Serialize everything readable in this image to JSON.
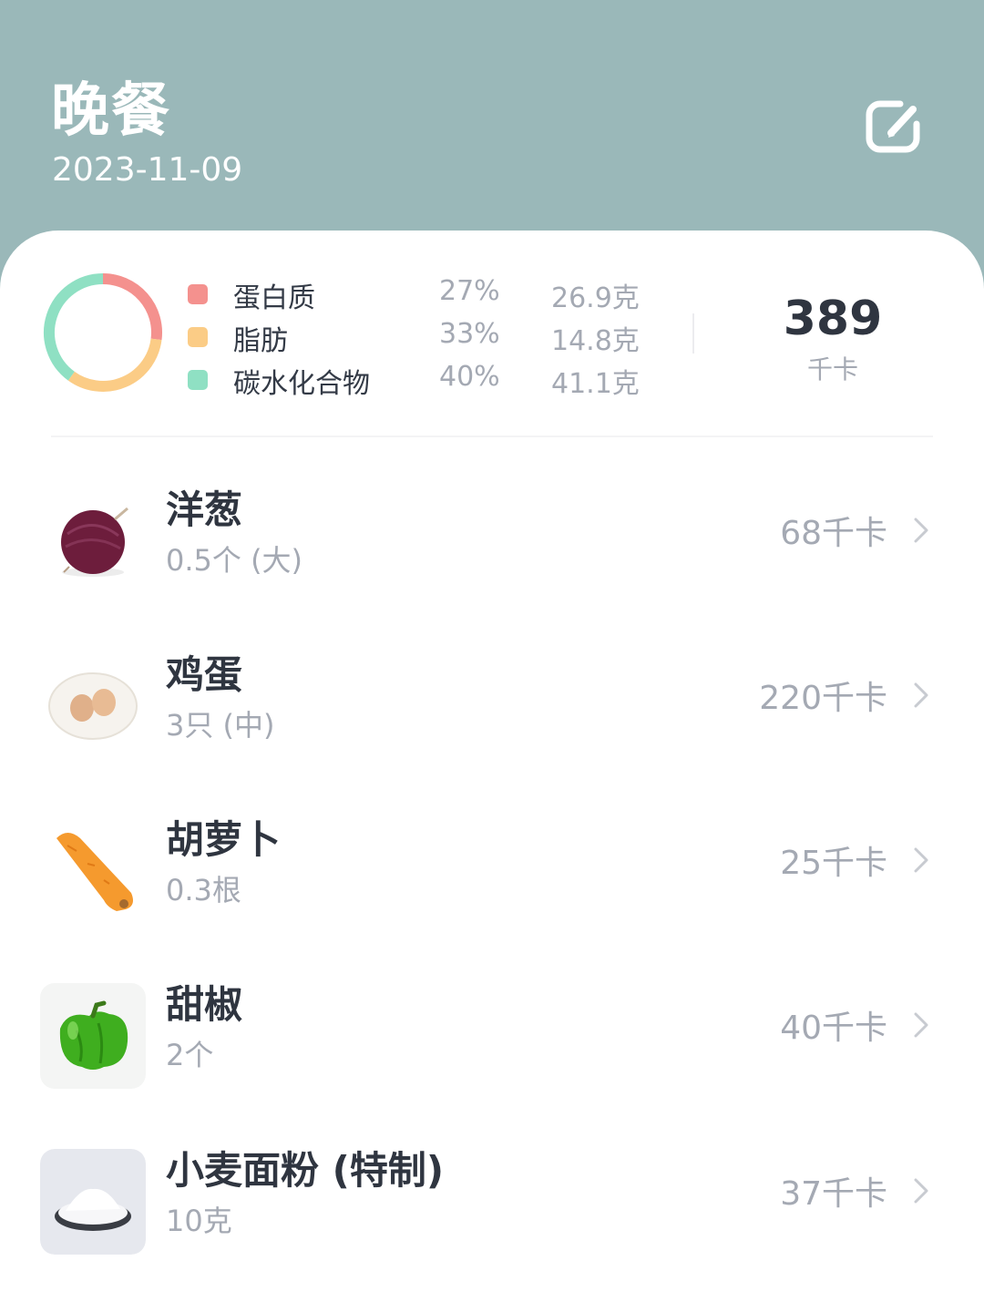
{
  "header": {
    "title": "晚餐",
    "date": "2023-11-09",
    "edit_icon": "edit-icon"
  },
  "summary": {
    "chart_data": {
      "type": "pie",
      "categories": [
        "蛋白质",
        "脂肪",
        "碳水化合物"
      ],
      "values": [
        27,
        33,
        40
      ],
      "colors": [
        "#f4918e",
        "#fbcc86",
        "#8fe0c3"
      ]
    },
    "macros": [
      {
        "name": "蛋白质",
        "percent": "27%",
        "grams": "26.9克",
        "color": "#f4918e"
      },
      {
        "name": "脂肪",
        "percent": "33%",
        "grams": "14.8克",
        "color": "#fbcc86"
      },
      {
        "name": "碳水化合物",
        "percent": "40%",
        "grams": "41.1克",
        "color": "#8fe0c3"
      }
    ],
    "total_kcal": "389",
    "total_unit": "千卡"
  },
  "foods": [
    {
      "name": "洋葱",
      "qty": "0.5个 (大)",
      "kcal": "68千卡",
      "icon": "onion-image"
    },
    {
      "name": "鸡蛋",
      "qty": "3只 (中)",
      "kcal": "220千卡",
      "icon": "eggs-image"
    },
    {
      "name": "胡萝卜",
      "qty": "0.3根",
      "kcal": "25千卡",
      "icon": "carrot-image"
    },
    {
      "name": "甜椒",
      "qty": "2个",
      "kcal": "40千卡",
      "icon": "bell-pepper-image"
    },
    {
      "name": "小麦面粉 (特制)",
      "qty": "10克",
      "kcal": "37千卡",
      "icon": "flour-image"
    }
  ]
}
